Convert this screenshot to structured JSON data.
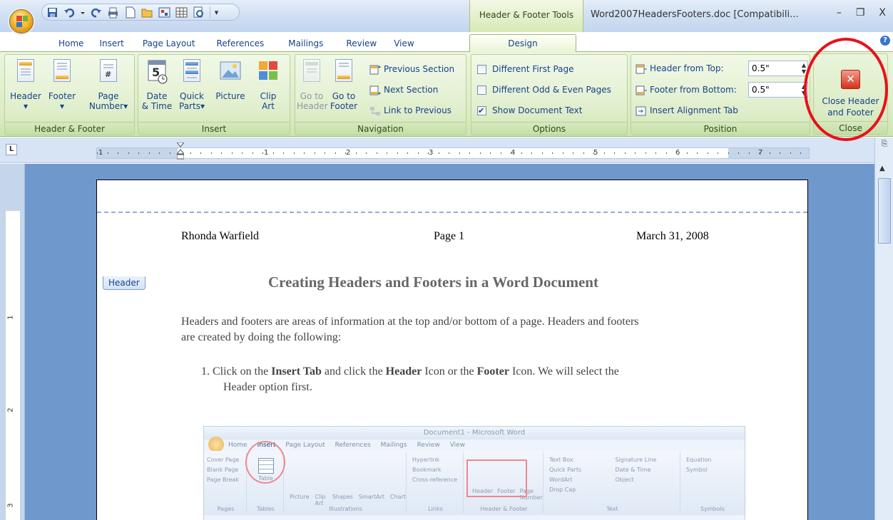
{
  "app": {
    "tool_context": "Header & Footer Tools",
    "doc_title": "Word2007HeadersFooters.doc [Compatibili...",
    "win_min": "–",
    "win_restore": "❐",
    "win_close": "X",
    "help": "?"
  },
  "tabs": [
    "Home",
    "Insert",
    "Page Layout",
    "References",
    "Mailings",
    "Review",
    "View"
  ],
  "active_tab": "Design",
  "ribbon": {
    "hf_group": {
      "label": "Header & Footer",
      "header": "Header",
      "footer": "Footer",
      "page": "Page",
      "number": "Number"
    },
    "insert_group": {
      "label": "Insert",
      "date1": "Date",
      "date2": "& Time",
      "quick1": "Quick",
      "quick2": "Parts",
      "picture": "Picture",
      "clip1": "Clip",
      "clip2": "Art"
    },
    "nav_group": {
      "label": "Navigation",
      "goto_header1": "Go to",
      "goto_header2": "Header",
      "goto_footer1": "Go to",
      "goto_footer2": "Footer",
      "prev_section": "Previous Section",
      "next_section": "Next Section",
      "link_prev": "Link to Previous"
    },
    "options_group": {
      "label": "Options",
      "diff_first": "Different First Page",
      "diff_odd_even": "Different Odd & Even Pages",
      "show_doc_text": "Show Document Text",
      "diff_first_checked": false,
      "diff_odd_even_checked": false,
      "show_doc_text_checked": true
    },
    "position_group": {
      "label": "Position",
      "header_top": "Header from Top:",
      "header_top_val": "0.5\"",
      "footer_bottom": "Footer from Bottom:",
      "footer_bottom_val": "0.5\"",
      "align_tab": "Insert Alignment Tab"
    },
    "close_group": {
      "label": "Close",
      "close1": "Close Header",
      "close2": "and Footer"
    }
  },
  "ruler": {
    "numbers": [
      "1",
      "1",
      "2",
      "3",
      "4",
      "5",
      "6",
      "7"
    ],
    "vnumbers": [
      "1",
      "2",
      "3"
    ],
    "tab_selector": "L"
  },
  "document": {
    "header_left": "Rhonda Warfield",
    "header_center": "Page 1",
    "header_right": "March 31, 2008",
    "header_tag": "Header",
    "heading": "Creating Headers and Footers in a Word Document",
    "para1_line1": "Headers and footers are areas of information at the top and/or bottom of a page. Headers and footers",
    "para1_line2": "are created by doing the following:",
    "step_num": "1.",
    "step_a": "Click on the ",
    "step_b": "Insert Tab",
    "step_c": " and click the ",
    "step_d": "Header",
    "step_e": " Icon or the ",
    "step_f": "Footer",
    "step_g": " Icon.   We will select the",
    "step_line2": "Header option first."
  },
  "embedded_screenshot": {
    "title": "Document1 - Microsoft Word",
    "tabs": [
      "Home",
      "Insert",
      "Page Layout",
      "References",
      "Mailings",
      "Review",
      "View"
    ],
    "groups": [
      "Pages",
      "Tables",
      "Illustrations",
      "Links",
      "Header & Footer",
      "Text",
      "Symbols"
    ],
    "items_pages": [
      "Cover Page",
      "Blank Page",
      "Page Break"
    ],
    "items_tables": [
      "Table"
    ],
    "items_ill": [
      "Picture",
      "Clip Art",
      "Shapes",
      "SmartArt",
      "Chart"
    ],
    "items_links": [
      "Hyperlink",
      "Bookmark",
      "Cross-reference"
    ],
    "items_hf": [
      "Header",
      "Footer",
      "Page Number"
    ],
    "items_text": [
      "Text Box",
      "Quick Parts",
      "WordArt",
      "Drop Cap",
      "Signature Line",
      "Date & Time",
      "Object"
    ],
    "items_symbols": [
      "Equation",
      "Symbol"
    ]
  },
  "colors": {
    "highlight": "#e8101b",
    "contextual_tab": "#d7e9b5",
    "workspace": "#6f99cd"
  }
}
